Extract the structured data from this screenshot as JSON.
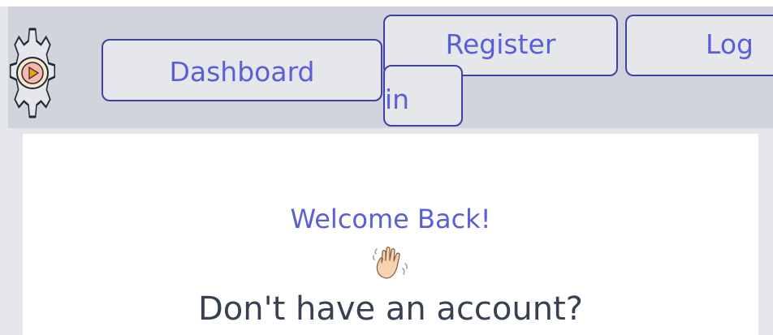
{
  "nav": {
    "logo_icon": "gear-play-icon",
    "dashboard_label": "Dashboard",
    "register_label": "Register",
    "login_label_line1": "Log",
    "login_label_line2": "in"
  },
  "main": {
    "welcome_title": "Welcome Back!",
    "wave_icon": "waving-hand-icon",
    "signup_prompt": "Don't have an account?"
  },
  "colors": {
    "accent": "#5b5fd6",
    "button_border": "#3f41a8",
    "navbar_bg": "#d1d5db",
    "page_bg": "#e5e7eb",
    "text_dark": "#374151"
  }
}
